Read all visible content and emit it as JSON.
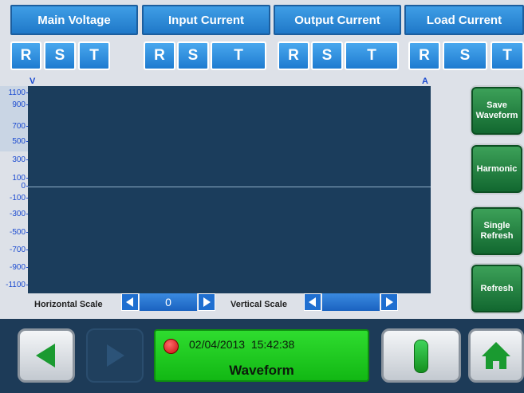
{
  "tabs": [
    "Main Voltage",
    "Input Current",
    "Output Current",
    "Load Current"
  ],
  "phases": [
    "R",
    "S",
    "T",
    "R",
    "S",
    "T",
    "R",
    "S",
    "T",
    "R",
    "S",
    "T"
  ],
  "chart": {
    "left_unit": "V",
    "right_unit": "A",
    "y_labels": [
      "1100",
      "900",
      "700",
      "500",
      "300",
      "100",
      "0",
      "-100",
      "-300",
      "-500",
      "-700",
      "-900",
      "-1100"
    ]
  },
  "side_buttons": [
    "Save Waveform",
    "Harmonic",
    "Single Refresh",
    "Refresh"
  ],
  "scale": {
    "horizontal_label": "Horizontal Scale",
    "horizontal_value": "0",
    "vertical_label": "Vertical Scale",
    "vertical_value": ""
  },
  "status": {
    "datetime": "02/04/2013  15:42:38",
    "title": "Waveform"
  },
  "colors": {
    "accent_blue": "#1f78c8",
    "status_green": "#22c922",
    "indicator_red": "#d41414"
  }
}
